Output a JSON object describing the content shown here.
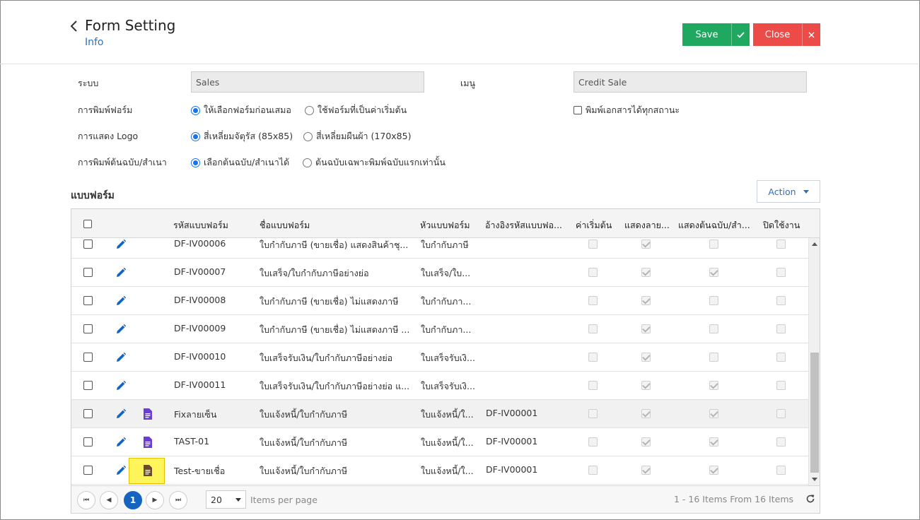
{
  "header": {
    "title": "Form Setting",
    "subtitle": "Info",
    "save_label": "Save",
    "close_label": "Close"
  },
  "form": {
    "system_label": "ระบบ",
    "system_value": "Sales",
    "menu_label": "เมนู",
    "menu_value": "Credit Sale",
    "print_form_label": "การพิมพ์ฟอร์ม",
    "print_form_options": [
      "ให้เลือกฟอร์มก่อนเสมอ",
      "ใช้ฟอร์มที่เป็นค่าเริ่มต้น"
    ],
    "print_form_selected": 0,
    "print_all_status_label": "พิมพ์เอกสารได้ทุกสถานะ",
    "logo_label": "การแสดง Logo",
    "logo_options": [
      "สี่เหลี่ยมจัตุรัส (85x85)",
      "สี่เหลี่ยมผืนผ้า (170x85)"
    ],
    "logo_selected": 0,
    "copy_label": "การพิมพ์ต้นฉบับ/สำเนา",
    "copy_options": [
      "เลือกต้นฉบับ/สำเนาได้",
      "ต้นฉบับเฉพาะพิมพ์ฉบับแรกเท่านั้น"
    ],
    "copy_selected": 0
  },
  "section": {
    "title": "แบบฟอร์ม",
    "action_label": "Action"
  },
  "grid": {
    "columns": [
      "รหัสแบบฟอร์ม",
      "ชื่อแบบฟอร์ม",
      "หัวแบบฟอร์ม",
      "อ้างอิงรหัสแบบฟอ...",
      "ค่าเริ่มต้น",
      "แสดงลาย...",
      "แสดงต้นฉบับ/สำ...",
      "ปิดใช้งาน"
    ],
    "rows": [
      {
        "code": "DF-IV00006",
        "name": "ใบกำกับภาษี (ขายเชื่อ) แสดงสินค้าชุ...",
        "header": "ใบกำกับภาษี",
        "ref": "",
        "has_doc": false,
        "default": false,
        "show_sign": true,
        "show_copy": false,
        "disabled": false
      },
      {
        "code": "DF-IV00007",
        "name": "ใบเสร็จ/ใบกำกับภาษีอย่างย่อ",
        "header": "ใบเสร็จ/ใบ...",
        "ref": "",
        "has_doc": false,
        "default": false,
        "show_sign": true,
        "show_copy": true,
        "disabled": false
      },
      {
        "code": "DF-IV00008",
        "name": "ใบกำกับภาษี (ขายเชื่อ) ไม่แสดงภาษี",
        "header": "ใบกำกับภา...",
        "ref": "",
        "has_doc": false,
        "default": false,
        "show_sign": true,
        "show_copy": false,
        "disabled": false
      },
      {
        "code": "DF-IV00009",
        "name": "ใบกำกับภาษี (ขายเชื่อ) ไม่แสดงภาษี ...",
        "header": "ใบกำกับภา...",
        "ref": "",
        "has_doc": false,
        "default": false,
        "show_sign": true,
        "show_copy": false,
        "disabled": false
      },
      {
        "code": "DF-IV00010",
        "name": "ใบเสร็จรับเงิน/ใบกำกับภาษีอย่างย่อ",
        "header": "ใบเสร็จรับเงิ...",
        "ref": "",
        "has_doc": false,
        "default": false,
        "show_sign": true,
        "show_copy": false,
        "disabled": false
      },
      {
        "code": "DF-IV00011",
        "name": "ใบเสร็จรับเงิน/ใบกำกับภาษีอย่างย่อ แ...",
        "header": "ใบเสร็จรับเงิ...",
        "ref": "",
        "has_doc": false,
        "default": false,
        "show_sign": true,
        "show_copy": true,
        "disabled": false
      },
      {
        "code": "Fixลายเซ็น",
        "name": "ใบแจ้งหนี้/ใบกำกับภาษี",
        "header": "ใบแจ้งหนี้/ใ...",
        "ref": "DF-IV00001",
        "has_doc": true,
        "default": false,
        "show_sign": true,
        "show_copy": true,
        "disabled": false
      },
      {
        "code": "TAST-01",
        "name": "ใบแจ้งหนี้/ใบกำกับภาษี",
        "header": "ใบแจ้งหนี้/ใ...",
        "ref": "DF-IV00001",
        "has_doc": true,
        "default": false,
        "show_sign": true,
        "show_copy": true,
        "disabled": false
      },
      {
        "code": "Test-ขายเชื่อ",
        "name": "ใบแจ้งหนี้/ใบกำกับภาษี",
        "header": "ใบแจ้งหนี้/ใ...",
        "ref": "DF-IV00001",
        "has_doc": true,
        "default": false,
        "show_sign": true,
        "show_copy": true,
        "disabled": false
      }
    ],
    "highlighted_row": 6,
    "highlighted_doc_row": 8
  },
  "pager": {
    "first_label": "⏮",
    "prev_label": "◀",
    "current_page": "1",
    "next_label": "▶",
    "last_label": "⏭",
    "page_size": "20",
    "per_page_label": "Items per page",
    "info": "1 - 16 Items From 16 Items"
  },
  "colors": {
    "save": "#1fa960",
    "close": "#ec4b48",
    "link": "#2c6fbf",
    "pencil": "#1565c0",
    "doc_icon": "#6a3ecf",
    "highlight": "#fff55a"
  },
  "icons": {
    "back": "chevron-left-icon",
    "save_side": "check-icon",
    "close_side": "close-icon",
    "edit": "pencil-icon",
    "doc": "document-icon",
    "refresh": "refresh-icon"
  }
}
